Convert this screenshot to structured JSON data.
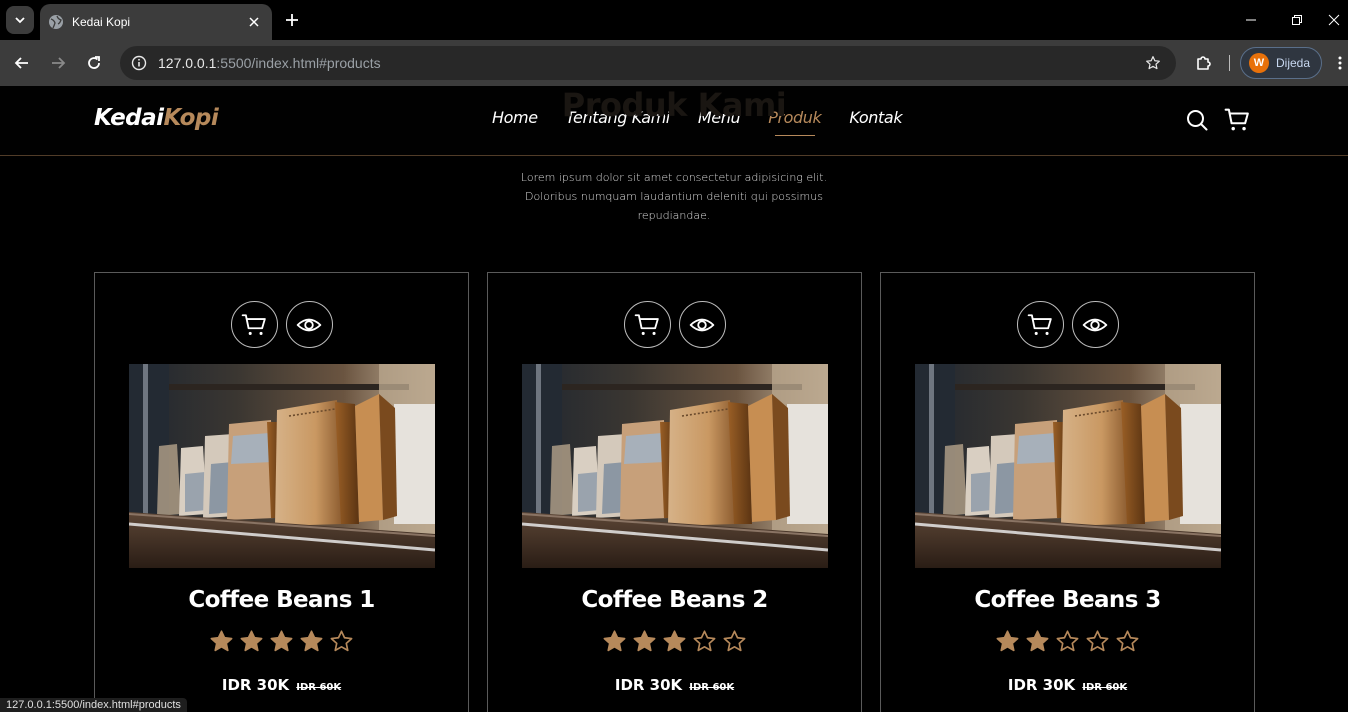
{
  "browser": {
    "tab_title": "Kedai Kopi",
    "url_host": "127.0.0.1",
    "url_path": ":5500/index.html#products",
    "profile_initial": "W",
    "profile_name": "Dijeda",
    "status_url": "127.0.0.1:5500/index.html#products"
  },
  "site": {
    "logo_part1": "Kedai",
    "logo_part2": "Kopi",
    "nav": [
      {
        "label": "Home"
      },
      {
        "label": "Tentang Kami"
      },
      {
        "label": "Menu"
      },
      {
        "label": "Produk"
      },
      {
        "label": "Kontak"
      }
    ],
    "active_nav": "Produk",
    "section_title": "Produk Kami",
    "description": "Lorem ipsum dolor sit amet consectetur adipisicing elit. Doloribus numquam laudantium deleniti qui possimus repudiandae.",
    "accent_color": "#b6895b"
  },
  "products": [
    {
      "name": "Coffee Beans 1",
      "rating": 4,
      "max_rating": 5,
      "price": "IDR 30K",
      "old_price": "IDR 60K"
    },
    {
      "name": "Coffee Beans 2",
      "rating": 3,
      "max_rating": 5,
      "price": "IDR 30K",
      "old_price": "IDR 60K"
    },
    {
      "name": "Coffee Beans 3",
      "rating": 2,
      "max_rating": 5,
      "price": "IDR 30K",
      "old_price": "IDR 60K"
    }
  ]
}
